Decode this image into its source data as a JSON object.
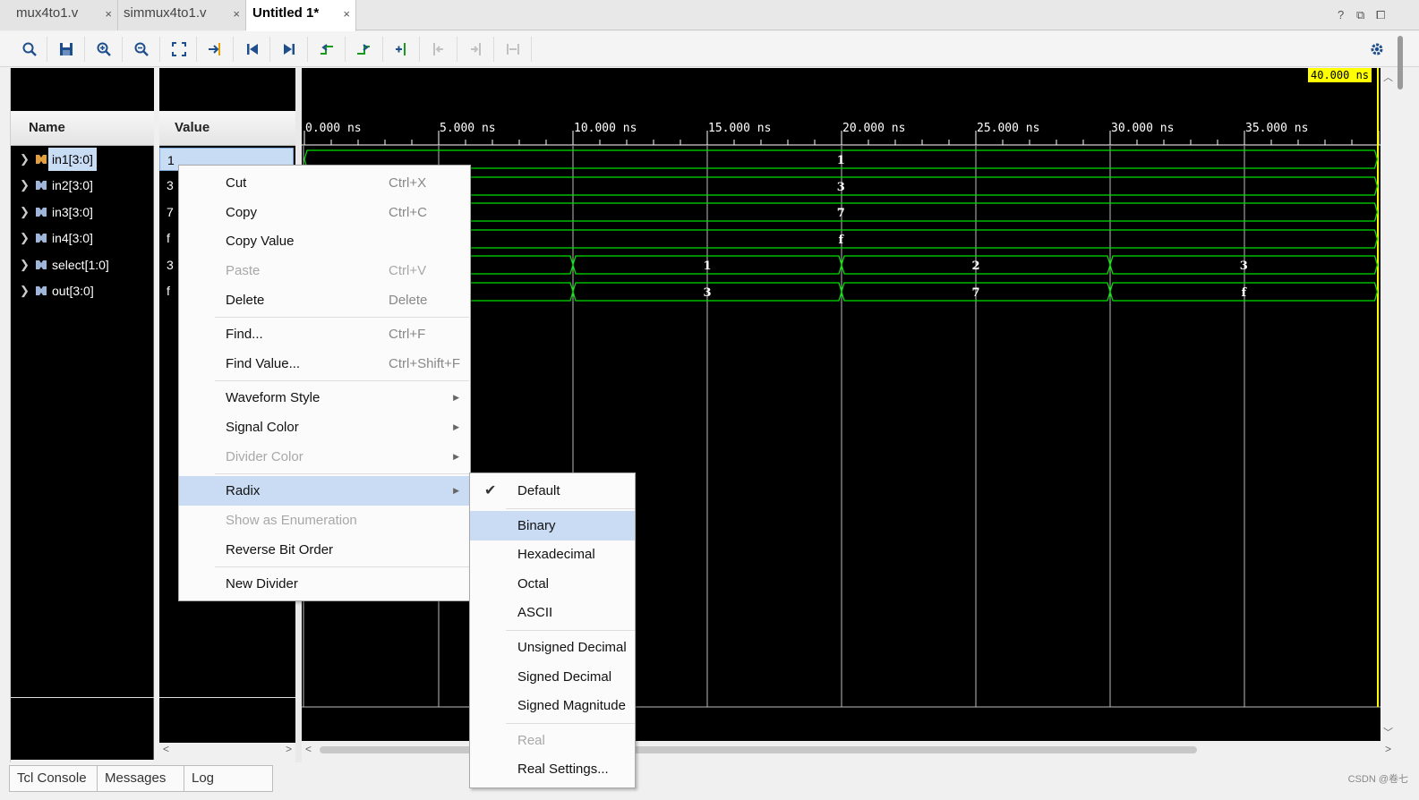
{
  "tabs": [
    {
      "label": "mux4to1.v",
      "close": "×"
    },
    {
      "label": "simmux4to1.v",
      "close": "×"
    },
    {
      "label": "Untitled 1*",
      "close": "×"
    }
  ],
  "window_controls": [
    "?",
    "⧉",
    "⧠"
  ],
  "toolbar_icons": [
    "search-icon",
    "save-icon",
    "zoom-in-icon",
    "zoom-out-icon",
    "zoom-fit-icon",
    "go-to-cursor-icon",
    "go-to-start-icon",
    "go-to-end-icon",
    "previous-transition-icon",
    "next-transition-icon",
    "add-marker-icon",
    "previous-marker-icon",
    "next-marker-icon",
    "swap-cursors-icon",
    "gear-icon"
  ],
  "name_header": "Name",
  "value_header": "Value",
  "signals": [
    {
      "name": "in1[3:0]",
      "value": "1"
    },
    {
      "name": "in2[3:0]",
      "value": "3"
    },
    {
      "name": "in3[3:0]",
      "value": "7"
    },
    {
      "name": "in4[3:0]",
      "value": "f"
    },
    {
      "name": "select[1:0]",
      "value": "3"
    },
    {
      "name": "out[3:0]",
      "value": "f"
    }
  ],
  "waveform": {
    "cursor_label": "40.000 ns",
    "time_labels": [
      "0.000 ns",
      "5.000 ns",
      "10.000 ns",
      "15.000 ns",
      "20.000 ns",
      "25.000 ns",
      "30.000 ns",
      "35.000 ns"
    ],
    "constant_values": [
      "1",
      "3",
      "7",
      "f"
    ],
    "select_segments": [
      "1",
      "2",
      "3"
    ],
    "out_segments": [
      "3",
      "7",
      "f"
    ],
    "wave_color": "#00e000"
  },
  "context_menu": {
    "items": [
      {
        "label": "Cut",
        "shortcut": "Ctrl+X"
      },
      {
        "label": "Copy",
        "shortcut": "Ctrl+C"
      },
      {
        "label": "Copy Value",
        "shortcut": ""
      },
      {
        "label": "Paste",
        "shortcut": "Ctrl+V",
        "disabled": true
      },
      {
        "label": "Delete",
        "shortcut": "Delete"
      },
      {
        "label": "Find...",
        "shortcut": "Ctrl+F"
      },
      {
        "label": "Find Value...",
        "shortcut": "Ctrl+Shift+F"
      },
      {
        "label": "Waveform Style",
        "submenu": true
      },
      {
        "label": "Signal Color",
        "submenu": true
      },
      {
        "label": "Divider Color",
        "submenu": true,
        "disabled": true
      },
      {
        "label": "Radix",
        "submenu": true,
        "highlighted": true
      },
      {
        "label": "Show as Enumeration",
        "disabled": true
      },
      {
        "label": "Reverse Bit Order"
      },
      {
        "label": "New Divider"
      }
    ]
  },
  "radix_menu": {
    "items": [
      {
        "label": "Default",
        "checked": true
      },
      {
        "label": "Binary",
        "highlighted": true
      },
      {
        "label": "Hexadecimal"
      },
      {
        "label": "Octal"
      },
      {
        "label": "ASCII"
      },
      {
        "label": "Unsigned Decimal"
      },
      {
        "label": "Signed Decimal"
      },
      {
        "label": "Signed Magnitude"
      },
      {
        "label": "Real",
        "disabled": true
      },
      {
        "label": "Real Settings..."
      }
    ]
  },
  "bottom_tabs": [
    "Tcl Console",
    "Messages",
    "Log"
  ],
  "watermark": "CSDN @卷七"
}
